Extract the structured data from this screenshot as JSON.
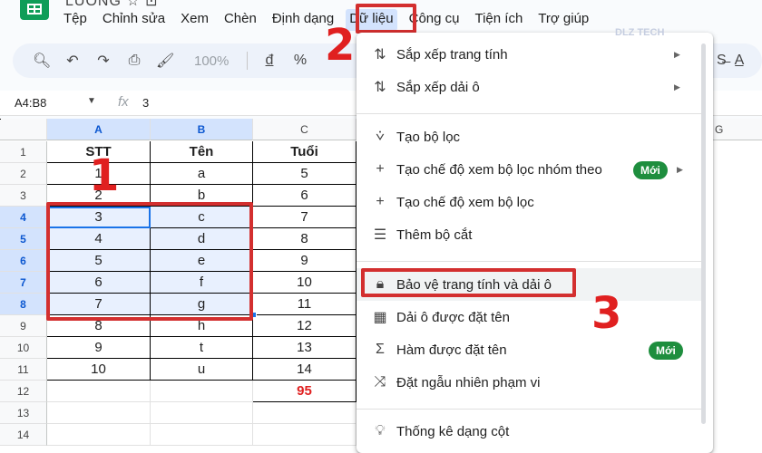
{
  "header": {
    "doc_title": "LUONG ☆ ⊡",
    "menu": [
      "Tệp",
      "Chỉnh sửa",
      "Xem",
      "Chèn",
      "Định dạng",
      "Dữ liệu",
      "Công cụ",
      "Tiện ích",
      "Trợ giúp"
    ]
  },
  "toolbar": {
    "zoom": "100%",
    "currency": "đ",
    "percent": "%"
  },
  "formula_bar": {
    "name_box": "A4:B8",
    "fx": "fx",
    "value": "3"
  },
  "grid": {
    "columns": [
      "A",
      "B",
      "C"
    ],
    "rows": [
      "1",
      "2",
      "3",
      "4",
      "5",
      "6",
      "7",
      "8",
      "9",
      "10",
      "11",
      "12",
      "13",
      "14"
    ],
    "header_row": [
      "STT",
      "Tên",
      "Tuổi"
    ],
    "data": [
      [
        "1",
        "a",
        "5"
      ],
      [
        "2",
        "b",
        "6"
      ],
      [
        "3",
        "c",
        "7"
      ],
      [
        "4",
        "d",
        "8"
      ],
      [
        "5",
        "e",
        "9"
      ],
      [
        "6",
        "f",
        "10"
      ],
      [
        "7",
        "g",
        "11"
      ],
      [
        "8",
        "h",
        "12"
      ],
      [
        "9",
        "t",
        "13"
      ],
      [
        "10",
        "u",
        "14"
      ]
    ],
    "total": "95",
    "g_column": "G"
  },
  "menu": {
    "items": [
      {
        "label": "Sắp xếp trang tính",
        "icon": "sort-icon"
      },
      {
        "label": "Sắp xếp dải ô",
        "icon": "sort-icon"
      },
      {
        "label": "Tạo bộ lọc",
        "icon": "filter-icon"
      },
      {
        "label": "Tạo chế độ xem bộ lọc nhóm theo",
        "icon": "plus-icon",
        "badge": "Mới"
      },
      {
        "label": "Tạo chế độ xem bộ lọc",
        "icon": "plus-icon"
      },
      {
        "label": "Thêm bộ cắt",
        "icon": "slicer-icon"
      },
      {
        "label": "Bảo vệ trang tính và dải ô",
        "icon": "lock-icon"
      },
      {
        "label": "Dải ô được đặt tên",
        "icon": "table-icon"
      },
      {
        "label": "Hàm được đặt tên",
        "icon": "sigma-icon",
        "badge": "Mới"
      },
      {
        "label": "Đặt ngẫu nhiên phạm vi",
        "icon": "shuffle-icon"
      },
      {
        "label": "Thống kê dạng cột",
        "icon": "lightbulb-icon"
      }
    ]
  },
  "annotations": {
    "step1": "1",
    "step2": "2",
    "step3": "3"
  },
  "watermark": "DLZ TECH"
}
